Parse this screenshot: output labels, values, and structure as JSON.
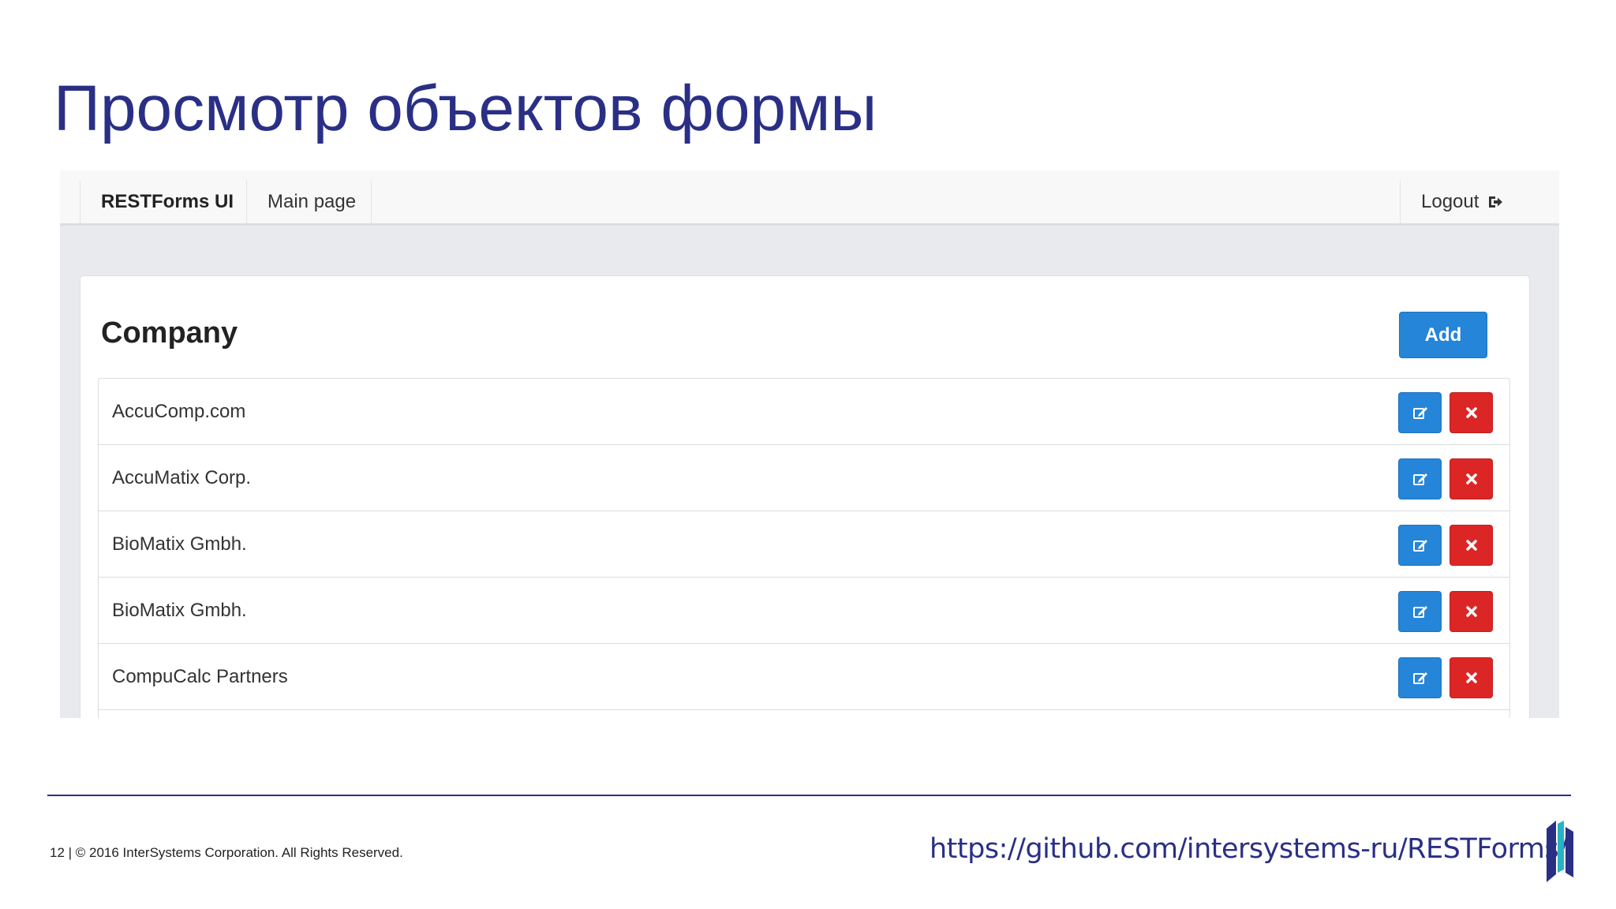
{
  "slide": {
    "title": "Просмотр объектов формы"
  },
  "navbar": {
    "brand": "RESTForms UI",
    "main_page": "Main page",
    "logout": "Logout"
  },
  "panel": {
    "title": "Company",
    "add_label": "Add"
  },
  "companies": [
    "AccuComp.com",
    "AccuMatix Corp.",
    "BioMatix Gmbh.",
    "BioMatix Gmbh.",
    "CompuCalc Partners"
  ],
  "footer": {
    "copyright": "12  |  © 2016 InterSystems Corporation. All Rights Reserved.",
    "url": "https://github.com/intersystems-ru/RESTForms/"
  },
  "colors": {
    "title": "#2a2f86",
    "primary_button": "#2585d8",
    "danger_button": "#dc2626",
    "app_background": "#e9eaee"
  },
  "icons": {
    "logout": "sign-out-icon",
    "edit": "edit-icon",
    "delete": "close-icon",
    "logo": "intersystems-logo"
  }
}
